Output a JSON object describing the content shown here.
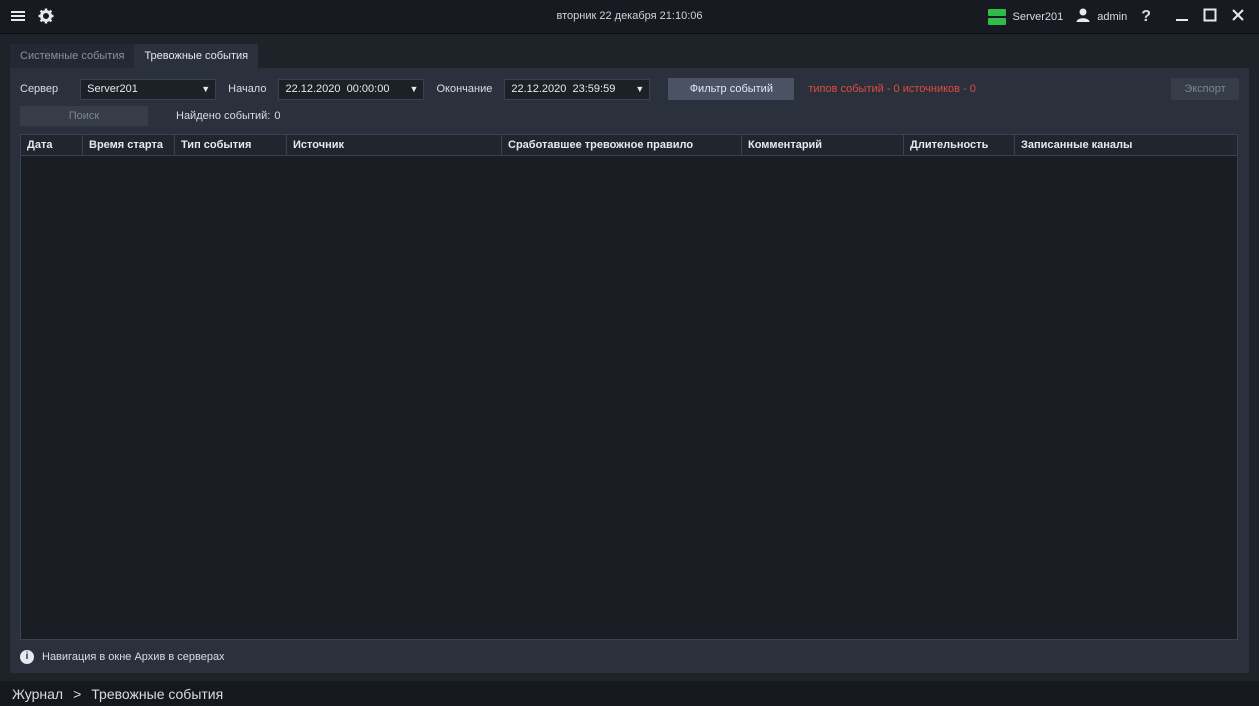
{
  "titlebar": {
    "datetime": "вторник 22 декабря 21:10:06",
    "server": "Server201",
    "user": "admin",
    "help": "?",
    "icons": [
      "menu-icon",
      "gear-icon",
      "server-icon",
      "user-icon",
      "help-icon",
      "minimize-icon",
      "maximize-icon",
      "close-icon"
    ]
  },
  "tabs": [
    {
      "label": "Системные события",
      "active": false
    },
    {
      "label": "Тревожные события",
      "active": true
    }
  ],
  "toolbar": {
    "server_label": "Сервер",
    "server_value": "Server201",
    "start_label": "Начало",
    "start_value": "22.12.2020  00:00:00",
    "end_label": "Окончание",
    "end_value": "22.12.2020  23:59:59",
    "filter_button": "Фильтр событий",
    "filter_status": "типов событий - 0 источников - 0",
    "export_button": "Экспорт",
    "search_button": "Поиск",
    "found_label": "Найдено событий:",
    "found_count": "0"
  },
  "table": {
    "columns": [
      "Дата",
      "Время старта",
      "Тип события",
      "Источник",
      "Сработавшее тревожное правило",
      "Комментарий",
      "Длительность",
      "Записанные каналы"
    ],
    "rows": []
  },
  "info": {
    "text": "Навигация в окне Архив в серверах"
  },
  "breadcrumb": {
    "root": "Журнал",
    "separator": ">",
    "current": "Тревожные события"
  },
  "colors": {
    "accent_red": "#e04a3f",
    "server_green": "#2fbd4a",
    "panel": "#2b313c"
  }
}
